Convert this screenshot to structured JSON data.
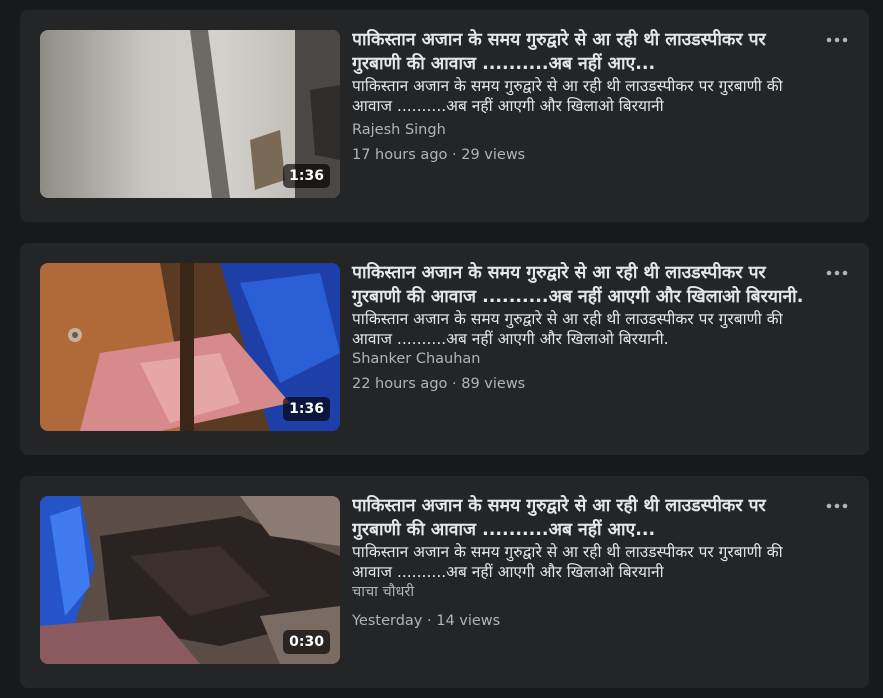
{
  "posts": [
    {
      "title": "पाकिस्तान अजान के समय गुरुद्वारे से आ रही थी लाउडस्पीकर पर गुरबाणी की आवाज ..........अब नहीं आए...",
      "description": "पाकिस्तान अजान के समय गुरुद्वारे से आ रही थी लाउडस्पीकर पर गुरबाणी की आवाज ..........अब नहीं आएगी और खिलाओ बिरयानी",
      "author": "Rajesh Singh",
      "meta": "17 hours ago · 29 views",
      "duration": "1:36",
      "thumbnail_icon": "video-thumbnail"
    },
    {
      "title": "पाकिस्तान अजान के समय गुरुद्वारे से आ रही थी लाउडस्पीकर पर गुरबाणी की आवाज ..........अब नहीं आएगी और खिलाओ बिरयानी.",
      "description": "पाकिस्तान अजान के समय गुरुद्वारे से आ रही थी लाउडस्पीकर पर गुरबाणी की आवाज ..........अब नहीं आएगी और खिलाओ बिरयानी.",
      "author": "Shanker Chauhan",
      "meta": "22 hours ago · 89 views",
      "duration": "1:36",
      "thumbnail_icon": "video-thumbnail"
    },
    {
      "title": "पाकिस्तान अजान के समय गुरुद्वारे से आ रही थी लाउडस्पीकर पर गुरबाणी की आवाज ..........अब नहीं आए...",
      "description": "पाकिस्तान अजान के समय गुरुद्वारे से आ रही थी लाउडस्पीकर पर गुरबाणी की आवाज ..........अब नहीं आएगी और खिलाओ बिरयानी",
      "author": "चाचा चौधरी",
      "meta": "Yesterday · 14 views",
      "duration": "0:30",
      "thumbnail_icon": "video-thumbnail"
    }
  ],
  "icons": {
    "more": "more-options-icon"
  },
  "colors": {
    "page_background": "#18191a",
    "card_background": "#242526",
    "primary_text": "#e4e6eb",
    "secondary_text": "#b0b3b8"
  }
}
